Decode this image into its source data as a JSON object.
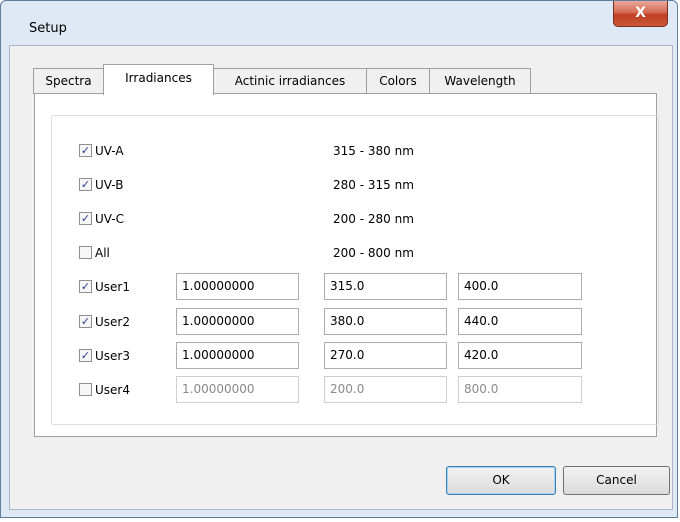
{
  "window": {
    "title": "Setup",
    "close_label": "X"
  },
  "tabs": [
    {
      "label": "Spectra"
    },
    {
      "label": "Irradiances"
    },
    {
      "label": "Actinic irradiances"
    },
    {
      "label": "Colors"
    },
    {
      "label": "Wavelength"
    }
  ],
  "active_tab": "Irradiances",
  "bands": [
    {
      "label": "UV-A",
      "checked": true,
      "range": "315 - 380 nm"
    },
    {
      "label": "UV-B",
      "checked": true,
      "range": "280 - 315 nm"
    },
    {
      "label": "UV-C",
      "checked": true,
      "range": "200 - 280 nm"
    },
    {
      "label": "All",
      "checked": false,
      "range": "200 - 800 nm"
    }
  ],
  "user_bands": [
    {
      "label": "User1",
      "checked": true,
      "factor": "1.00000000",
      "from": "315.0",
      "to": "400.0",
      "enabled": true
    },
    {
      "label": "User2",
      "checked": true,
      "factor": "1.00000000",
      "from": "380.0",
      "to": "440.0",
      "enabled": true
    },
    {
      "label": "User3",
      "checked": true,
      "factor": "1.00000000",
      "from": "270.0",
      "to": "420.0",
      "enabled": true
    },
    {
      "label": "User4",
      "checked": false,
      "factor": "1.00000000",
      "from": "200.0",
      "to": "800.0",
      "enabled": false
    }
  ],
  "buttons": {
    "ok": "OK",
    "cancel": "Cancel"
  },
  "colors": {
    "window_frame": "#dfe9f5",
    "close_button": "#c23f22",
    "check_mark": "#2a3c8a"
  }
}
